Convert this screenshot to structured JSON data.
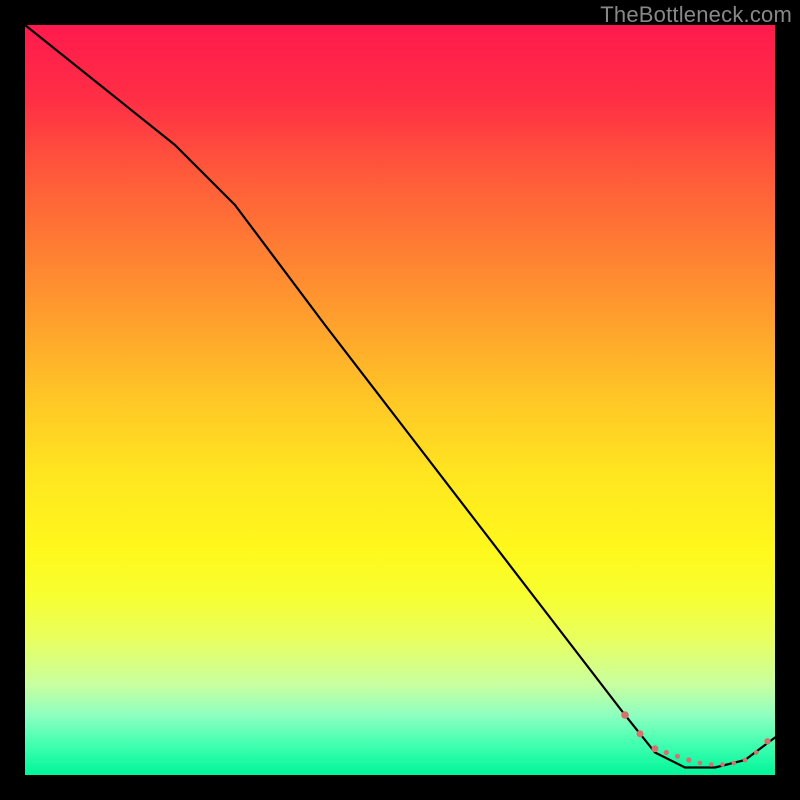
{
  "watermark": "TheBottleneck.com",
  "colors": {
    "background": "#000000",
    "curve": "#000000",
    "dot": "#d97070"
  },
  "chart_data": {
    "type": "line",
    "title": "",
    "xlabel": "",
    "ylabel": "",
    "xlim": [
      0,
      100
    ],
    "ylim": [
      0,
      100
    ],
    "gradient_stops": [
      {
        "pos": 0,
        "color": "#ff1a4d"
      },
      {
        "pos": 10,
        "color": "#ff2f45"
      },
      {
        "pos": 20,
        "color": "#ff5a3a"
      },
      {
        "pos": 30,
        "color": "#ff7e33"
      },
      {
        "pos": 40,
        "color": "#ffa22d"
      },
      {
        "pos": 50,
        "color": "#ffc726"
      },
      {
        "pos": 60,
        "color": "#ffe620"
      },
      {
        "pos": 70,
        "color": "#fff81c"
      },
      {
        "pos": 76,
        "color": "#f7ff30"
      },
      {
        "pos": 82,
        "color": "#e8ff60"
      },
      {
        "pos": 88,
        "color": "#c8ffa0"
      },
      {
        "pos": 92,
        "color": "#8effc0"
      },
      {
        "pos": 96,
        "color": "#40ffb0"
      },
      {
        "pos": 100,
        "color": "#00f59a"
      }
    ],
    "series": [
      {
        "name": "bottleneck_pct",
        "x": [
          0,
          10,
          20,
          28,
          40,
          50,
          60,
          70,
          80,
          84,
          88,
          92,
          96,
          100
        ],
        "y": [
          100,
          92,
          84,
          76,
          60,
          47,
          34,
          21,
          8,
          3,
          1,
          1,
          2,
          5
        ]
      }
    ],
    "optimal_range_dots": {
      "x": [
        80,
        82,
        84,
        85.5,
        87,
        88.5,
        90,
        91.5,
        93,
        94.5,
        96,
        97.5,
        99
      ],
      "y": [
        8,
        5.5,
        3.5,
        3,
        2.5,
        2,
        1.6,
        1.4,
        1.4,
        1.6,
        2,
        3,
        4.5
      ],
      "radius": [
        3.8,
        3.5,
        3.5,
        2.6,
        2.6,
        2.6,
        2.3,
        2.3,
        2.3,
        2.3,
        2.3,
        2.3,
        3.2
      ]
    }
  }
}
